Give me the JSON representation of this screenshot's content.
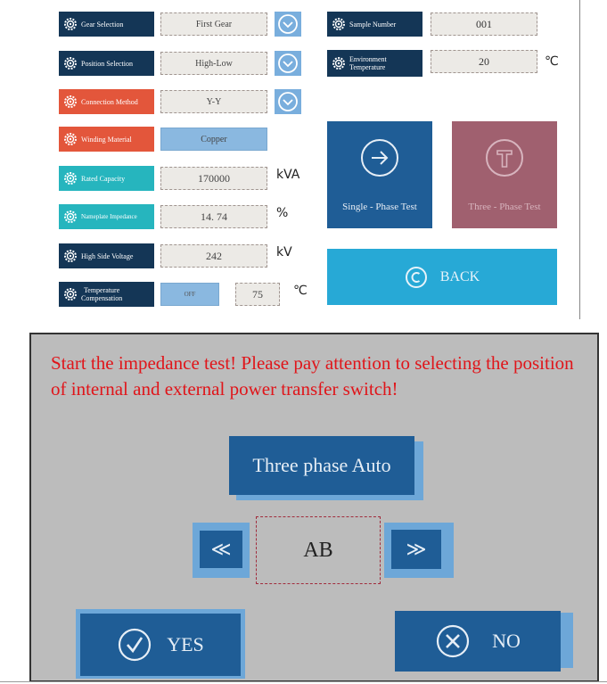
{
  "settings": {
    "gear_selection": {
      "label": "Gear Selection",
      "value": "First Gear"
    },
    "position_selection": {
      "label": "Position Selection",
      "value": "High-Low"
    },
    "connection_method": {
      "label": "Connection Method",
      "value": "Y-Y"
    },
    "winding_material": {
      "label": "Winding Material",
      "value": "Copper"
    },
    "rated_capacity": {
      "label": "Rated Capacity",
      "value": "170000",
      "unit": "kVA"
    },
    "nameplate_impedance": {
      "label": "Nameplate Impedance",
      "value": "14. 74",
      "unit": "%"
    },
    "high_side_voltage": {
      "label": "High Side Voltage",
      "value": "242",
      "unit": "kV"
    },
    "temperature_compensation": {
      "label_line1": "Temperature",
      "label_line2": "Compensation",
      "toggle": "OFF",
      "value": "75",
      "unit": "℃"
    }
  },
  "sample": {
    "sample_number": {
      "label": "Sample Number",
      "value": "001"
    },
    "environment_temperature": {
      "label_line1": "Environment",
      "label_line2": "Temperature",
      "value": "20",
      "unit": "℃"
    }
  },
  "actions": {
    "single_phase": "Single - Phase Test",
    "three_phase": "Three - Phase Test",
    "back": "BACK"
  },
  "dialog": {
    "message": "Start the impedance test! Please pay attention to selecting the position of internal and external power transfer switch!",
    "mode_button": "Three phase Auto",
    "prev_label": "≪",
    "next_label": "≫",
    "phase_value": "AB",
    "yes_label": "YES",
    "no_label": "NO"
  },
  "colors": {
    "navy": "#143656",
    "orange": "#e3563b",
    "teal": "#26b5be",
    "single_phase_bg": "#1f5d96",
    "three_phase_bg": "#a0606f",
    "back_bg": "#27a9d6",
    "message_red": "#e0151a"
  }
}
